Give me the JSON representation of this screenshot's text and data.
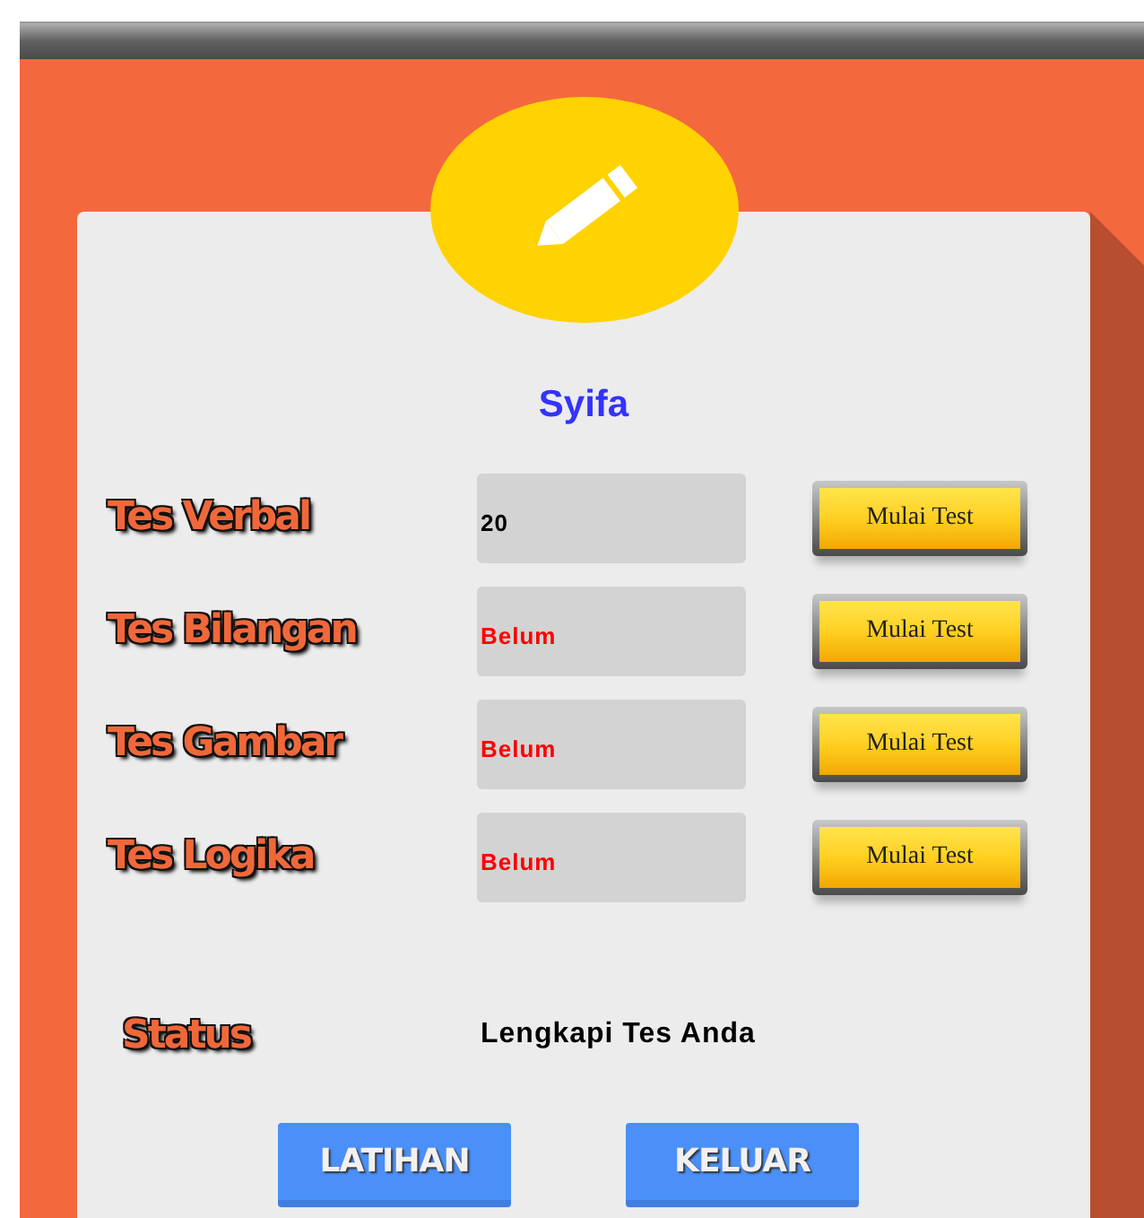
{
  "user_name": "Syifa",
  "tests": [
    {
      "label": "Tes Verbal",
      "result": "20",
      "completed": true,
      "button": "Mulai Test"
    },
    {
      "label": "Tes Bilangan",
      "result": "Belum",
      "completed": false,
      "button": "Mulai Test"
    },
    {
      "label": "Tes Gambar",
      "result": "Belum",
      "completed": false,
      "button": "Mulai Test"
    },
    {
      "label": "Tes Logika",
      "result": "Belum",
      "completed": false,
      "button": "Mulai Test"
    }
  ],
  "status": {
    "label": "Status",
    "message": "Lengkapi Tes Anda"
  },
  "buttons": [
    "LATIHAN",
    "KELUAR"
  ]
}
